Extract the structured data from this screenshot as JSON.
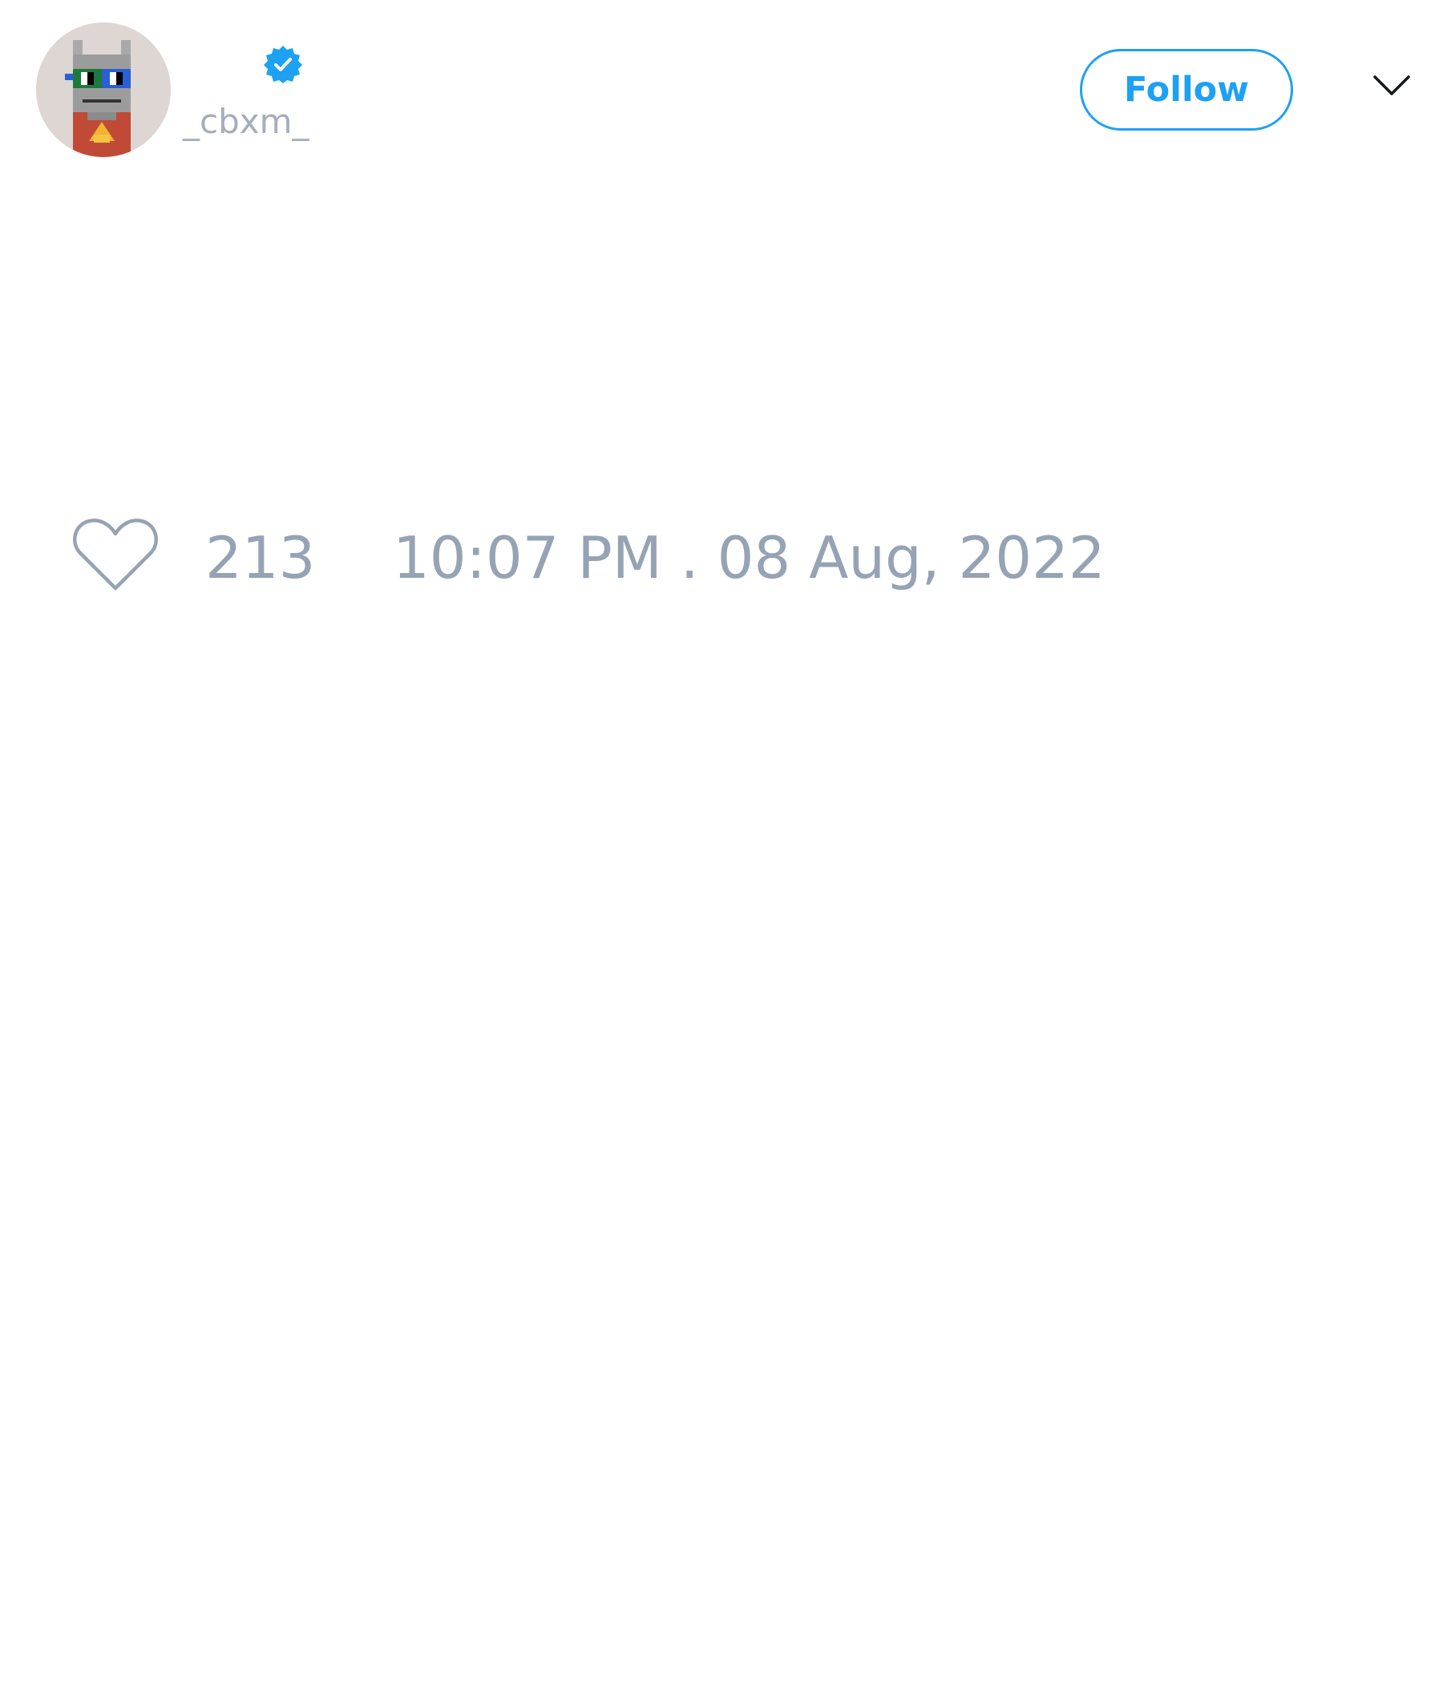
{
  "author": {
    "display_name": "",
    "handle": "_cbxm_",
    "verified": true,
    "avatar_icon": "pixel-art-avatar-icon"
  },
  "header": {
    "follow_label": "Follow",
    "menu_icon": "chevron-down-icon"
  },
  "tweet": {
    "text": ""
  },
  "footer": {
    "like_icon": "heart-outline-icon",
    "like_count": "213",
    "timestamp": "10:07 PM . 08 Aug, 2022"
  },
  "colors": {
    "accent": "#1da1f2",
    "muted_text": "#95a3b4",
    "handle_text": "#a5adbd",
    "avatar_background": "#ddd6d3"
  }
}
